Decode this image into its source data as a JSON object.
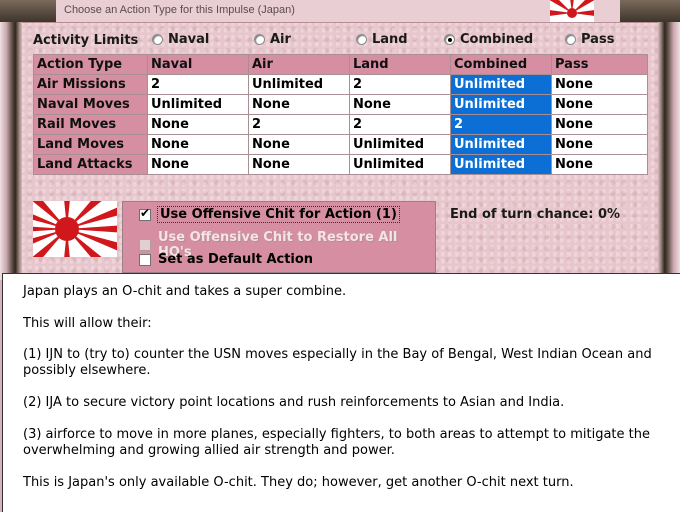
{
  "window": {
    "title": "Choose an Action Type for this Impulse (Japan)"
  },
  "activity_limits": {
    "label": "Activity Limits",
    "options": [
      {
        "label": "Naval",
        "selected": false
      },
      {
        "label": "Air",
        "selected": false
      },
      {
        "label": "Land",
        "selected": false
      },
      {
        "label": "Combined",
        "selected": true
      },
      {
        "label": "Pass",
        "selected": false
      }
    ]
  },
  "table": {
    "headers": [
      "Action Type",
      "Naval",
      "Air",
      "Land",
      "Combined",
      "Pass"
    ],
    "rows": [
      [
        "Air Missions",
        "2",
        "Unlimited",
        "2",
        "Unlimited",
        "None"
      ],
      [
        "Naval Moves",
        "Unlimited",
        "None",
        "None",
        "Unlimited",
        "None"
      ],
      [
        "Rail Moves",
        "None",
        "2",
        "2",
        "2",
        "None"
      ],
      [
        "Land Moves",
        "None",
        "None",
        "Unlimited",
        "Unlimited",
        "None"
      ],
      [
        "Land Attacks",
        "None",
        "None",
        "Unlimited",
        "Unlimited",
        "None"
      ]
    ],
    "selected_column_index": 4
  },
  "options": {
    "offensive_chit": {
      "label": "Use Offensive Chit for Action (1)",
      "checked": true,
      "enabled": true
    },
    "restore_hqs": {
      "label": "Use Offensive Chit to Restore All HQ's",
      "checked": false,
      "enabled": false
    },
    "default_action": {
      "label": "Set as Default Action",
      "checked": false,
      "enabled": true
    }
  },
  "end_of_turn": "End of turn chance: 0%",
  "note": {
    "paragraphs": [
      "Japan plays an O-chit and takes a super combine.",
      "This will allow their:",
      "(1) IJN to (try to) counter the USN moves especially in the Bay of Bengal, West Indian Ocean and possibly elsewhere.",
      "(2) IJA to secure victory point locations and rush reinforcements to Asian and India.",
      "(3) airforce to move in more planes, especially fighters, to both areas to attempt to mitigate the overwhelming and growing allied air strength and power.",
      "This is Japan's only available O-chit.   They do; however, get another O-chit next turn."
    ]
  },
  "colors": {
    "header_pink": "#d68fa2",
    "selected_blue": "#0b6fd6",
    "flag_red": "#d0181c"
  }
}
